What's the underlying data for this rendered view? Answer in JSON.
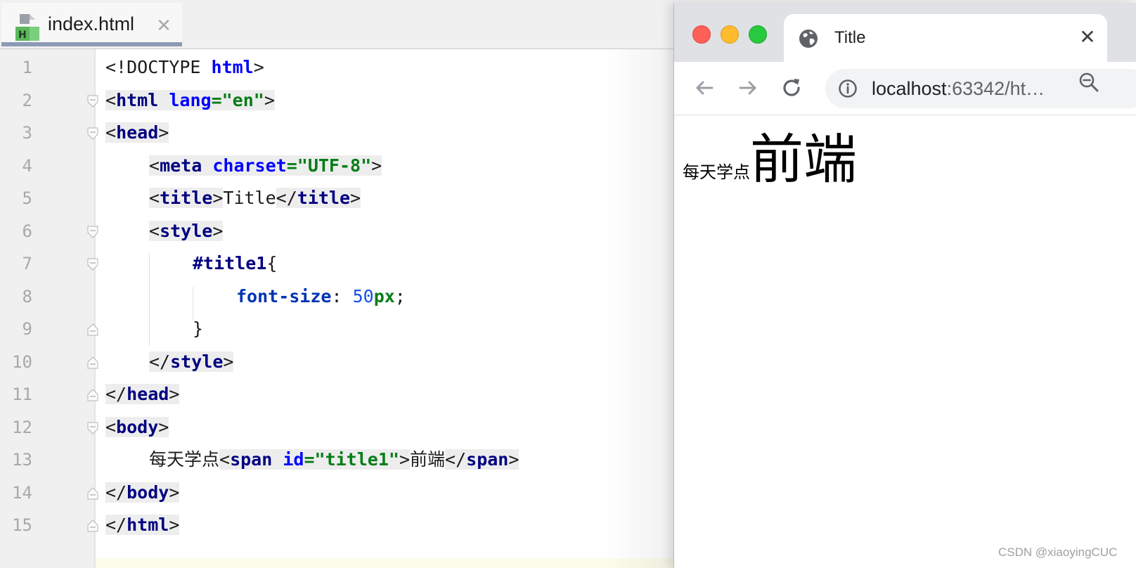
{
  "ide": {
    "tab": {
      "label": "index.html",
      "close_glyph": "✕",
      "icon": "html-file-icon"
    },
    "line_numbers": [
      "1",
      "2",
      "3",
      "4",
      "5",
      "6",
      "7",
      "8",
      "9",
      "10",
      "11",
      "12",
      "13",
      "14",
      "15"
    ],
    "code": {
      "l1": {
        "doctype": "<!DOCTYPE ",
        "html": "html",
        "close": ">"
      },
      "l2": {
        "open": "<",
        "tag": "html",
        "sp": " ",
        "attr": "lang",
        "eq": "=",
        "val": "\"en\"",
        "close": ">"
      },
      "l3": {
        "open": "<",
        "tag": "head",
        "close": ">"
      },
      "l4": {
        "open": "<",
        "tag": "meta",
        "sp": " ",
        "attr": "charset",
        "eq": "=",
        "val": "\"UTF-8\"",
        "close": ">"
      },
      "l5": {
        "open": "<",
        "tag": "title",
        "close": ">",
        "text": "Title",
        "open2": "</",
        "tag2": "title",
        "close2": ">"
      },
      "l6": {
        "open": "<",
        "tag": "style",
        "close": ">"
      },
      "l7": {
        "selector": "#title1",
        "brace": "{"
      },
      "l8": {
        "prop": "font-size",
        "colon": ": ",
        "num": "50",
        "unit": "px",
        "semi": ";"
      },
      "l9": {
        "brace": "}"
      },
      "l10": {
        "open": "</",
        "tag": "style",
        "close": ">"
      },
      "l11": {
        "open": "</",
        "tag": "head",
        "close": ">"
      },
      "l12": {
        "open": "<",
        "tag": "body",
        "close": ">"
      },
      "l13": {
        "text": "每天学点",
        "open": "<",
        "tag": "span",
        "sp": " ",
        "attr": "id",
        "eq": "=",
        "val": "\"title1\"",
        "close": ">",
        "text2": "前端",
        "open2": "</",
        "tag2": "span",
        "close2": ">"
      },
      "l14": {
        "open": "</",
        "tag": "body",
        "close": ">"
      },
      "l15": {
        "open": "</",
        "tag": "html",
        "close": ">"
      }
    }
  },
  "browser": {
    "tab_title": "Title",
    "tab_close": "✕",
    "url_host": "localhost",
    "url_rest": ":63342/ht…",
    "page": {
      "small_text": "每天学点",
      "big_text": "前端"
    }
  },
  "watermark": "CSDN @xiaoyingCUC",
  "colors": {
    "tag": "#000080",
    "attr": "#0000ff",
    "string": "#067d17",
    "number": "#1750eb",
    "traffic_red": "#fe5f57",
    "traffic_yellow": "#febc2e",
    "traffic_green": "#28c840"
  }
}
